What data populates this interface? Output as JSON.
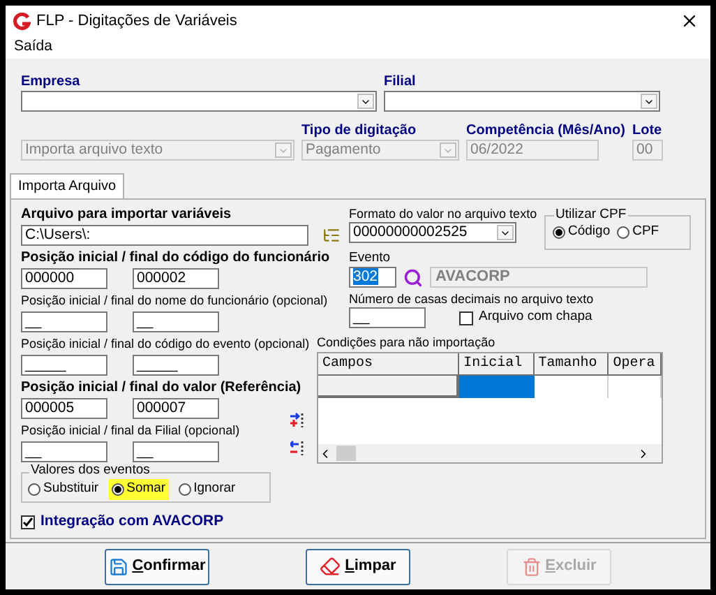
{
  "window": {
    "title": "FLP - Digitações de Variáveis"
  },
  "menu": [
    {
      "label": "Saída"
    }
  ],
  "header": {
    "empresa": {
      "label": "Empresa"
    },
    "filial": {
      "label": "Filial"
    },
    "modo": {
      "value": "Importa arquivo texto",
      "disabled": true
    },
    "tipo": {
      "label": "Tipo de digitação",
      "value": "Pagamento",
      "disabled": true
    },
    "competencia": {
      "label": "Competência (Mês/Ano)",
      "value": "06/2022",
      "disabled": true
    },
    "lote": {
      "label": "Lote",
      "value": "00",
      "disabled": true
    }
  },
  "tabs": [
    {
      "label": "Importa Arquivo",
      "selected": true
    }
  ],
  "arquivo": {
    "label": "Arquivo para importar variáveis",
    "value": "C:\\Users\\:"
  },
  "positions": [
    {
      "label": "Posição inicial / final do código do funcionário",
      "kind": "required",
      "start": "000000",
      "end": "000002"
    },
    {
      "label": "Posição inicial / final do nome do funcionário (opcional)",
      "kind": "optional",
      "start": "__",
      "end": "__"
    },
    {
      "label": "Posição inicial / final do código do evento (opcional)",
      "kind": "optional",
      "start": "_____",
      "end": "_____"
    },
    {
      "label": "Posição inicial / final do valor (Referência)",
      "kind": "required",
      "start": "000005",
      "end": "000007"
    },
    {
      "label": "Posição inicial / final da Filial  (opcional)",
      "kind": "optional",
      "start": "__",
      "end": "__"
    }
  ],
  "valores": {
    "label": "Valores dos eventos",
    "options": [
      {
        "label": "Substituir",
        "selected": false,
        "highlighted": false
      },
      {
        "label": "Somar",
        "selected": true,
        "highlighted": true
      },
      {
        "label": "Ignorar",
        "selected": false,
        "highlighted": false
      }
    ]
  },
  "integracao": {
    "label": "Integração com AVACORP",
    "checked": true
  },
  "formato": {
    "label": "Formato do valor no arquivo texto",
    "value": "00000000002525"
  },
  "cpf": {
    "label": "Utilizar CPF",
    "options": [
      {
        "label": "Código",
        "selected": true
      },
      {
        "label": "CPF",
        "selected": false
      }
    ]
  },
  "evento": {
    "label": "Evento",
    "value": "302",
    "description": "AVACORP"
  },
  "decimais": {
    "label": "Número de casas decimais no arquivo texto",
    "value": "__"
  },
  "chapa": {
    "label": "Arquivo com chapa",
    "checked": false
  },
  "condicoes": {
    "label": "Condições para não importação",
    "columns": [
      "Campos",
      "Inicial",
      "Tamanho",
      "Opera"
    ],
    "rows": [
      {
        "cells": [
          {
            "selected": false
          },
          {
            "selected": true
          },
          {
            "selected": false
          },
          {
            "selected": false
          }
        ]
      }
    ]
  },
  "buttons": [
    {
      "label": "Confirmar",
      "kind": "save",
      "disabled": false
    },
    {
      "label": "Limpar",
      "kind": "clear",
      "disabled": false
    },
    {
      "label": "Excluir",
      "kind": "delete",
      "disabled": true
    }
  ]
}
